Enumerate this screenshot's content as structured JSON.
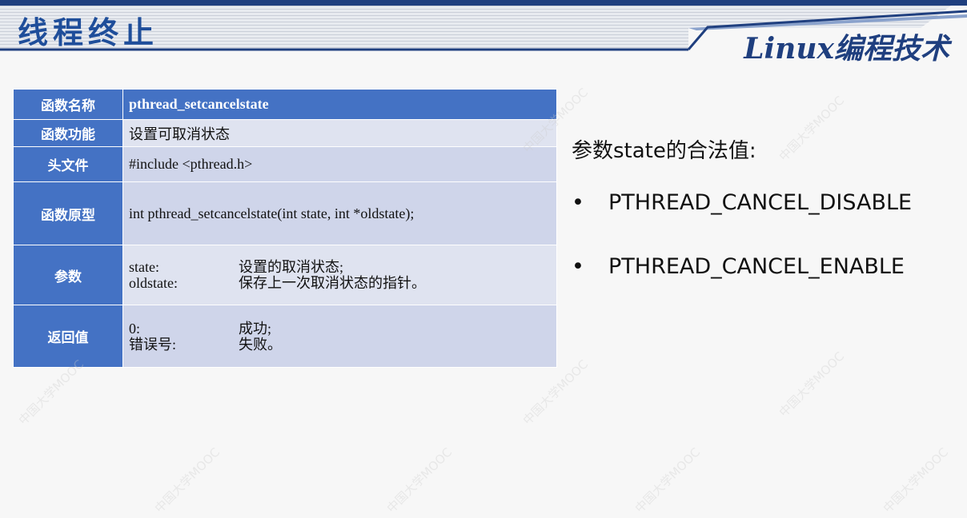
{
  "header": {
    "title": "线程终止",
    "brand": "Linux编程技术"
  },
  "table": {
    "rows": [
      {
        "key": "函数名称",
        "value": "pthread_setcancelstate"
      },
      {
        "key": "函数功能",
        "value": "设置可取消状态"
      },
      {
        "key": "头文件",
        "value": "#include <pthread.h>"
      },
      {
        "key": "函数原型",
        "value": "int pthread_setcancelstate(int state, int *oldstate);"
      },
      {
        "key": "参数",
        "pairs": [
          {
            "a": "state:",
            "b": "设置的取消状态;"
          },
          {
            "a": "oldstate:",
            "b": "保存上一次取消状态的指针。"
          }
        ]
      },
      {
        "key": "返回值",
        "pairs": [
          {
            "a": "0:",
            "b": "成功;"
          },
          {
            "a": "错误号:",
            "b": "失败。"
          }
        ]
      }
    ]
  },
  "right": {
    "subtitle": "参数state的合法值:",
    "values": [
      "PTHREAD_CANCEL_DISABLE",
      "PTHREAD_CANCEL_ENABLE"
    ]
  },
  "watermark": "中国大学MOOC",
  "colors": {
    "title": "#1f4e9a",
    "header_fill": "#4472c4",
    "row_dark": "#cfd5ea",
    "row_light": "#dfe3f0"
  }
}
